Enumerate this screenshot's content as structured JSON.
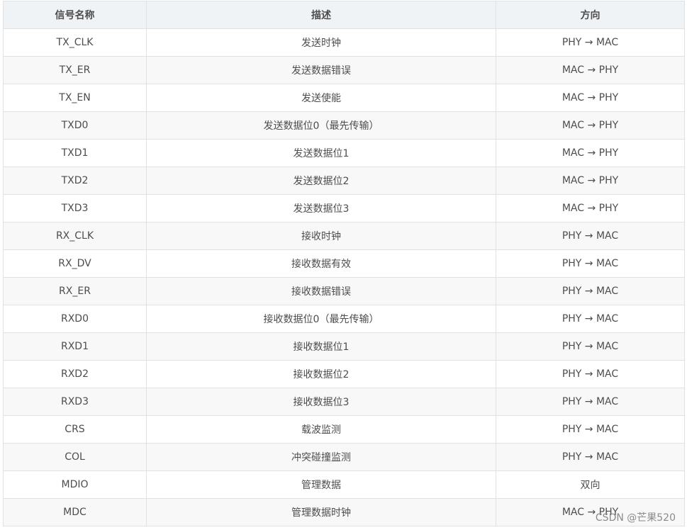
{
  "table": {
    "headers": [
      "信号名称",
      "描述",
      "方向"
    ],
    "rows": [
      [
        "TX_CLK",
        "发送时钟",
        "PHY → MAC"
      ],
      [
        "TX_ER",
        "发送数据错误",
        "MAC → PHY"
      ],
      [
        "TX_EN",
        "发送使能",
        "MAC → PHY"
      ],
      [
        "TXD0",
        "发送数据位0（最先传输）",
        "MAC → PHY"
      ],
      [
        "TXD1",
        "发送数据位1",
        "MAC → PHY"
      ],
      [
        "TXD2",
        "发送数据位2",
        "MAC → PHY"
      ],
      [
        "TXD3",
        "发送数据位3",
        "MAC → PHY"
      ],
      [
        "RX_CLK",
        "接收时钟",
        "PHY → MAC"
      ],
      [
        "RX_DV",
        "接收数据有效",
        "PHY → MAC"
      ],
      [
        "RX_ER",
        "接收数据错误",
        "PHY → MAC"
      ],
      [
        "RXD0",
        "接收数据位0（最先传输）",
        "PHY → MAC"
      ],
      [
        "RXD1",
        "接收数据位1",
        "PHY → MAC"
      ],
      [
        "RXD2",
        "接收数据位2",
        "PHY → MAC"
      ],
      [
        "RXD3",
        "接收数据位3",
        "PHY → MAC"
      ],
      [
        "CRS",
        "载波监测",
        "PHY → MAC"
      ],
      [
        "COL",
        "冲突碰撞监测",
        "PHY → MAC"
      ],
      [
        "MDIO",
        "管理数据",
        "双向"
      ],
      [
        "MDC",
        "管理数据时钟",
        "MAC → PHY"
      ]
    ]
  },
  "watermark": "CSDN @芒果520",
  "colors": {
    "header_bg": "#eff3f5",
    "row_alt_bg": "#f8f8f8",
    "border": "#dfe2e5",
    "text": "#4d4d4d"
  }
}
